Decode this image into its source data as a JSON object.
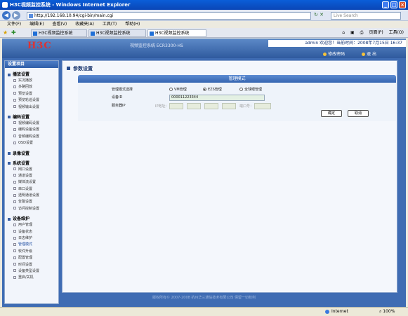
{
  "window": {
    "title": "H3C视频监控系统 - Windows Internet Explorer"
  },
  "addressbar": {
    "url": "http://192.168.10.94/cgi-bin/main.cgi",
    "search_placeholder": "Live Search"
  },
  "menubar": [
    "文件(F)",
    "编辑(E)",
    "查看(V)",
    "收藏夹(A)",
    "工具(T)",
    "帮助(H)"
  ],
  "tabs": [
    {
      "label": "H3C视频监控系统"
    },
    {
      "label": "H3C视频监控系统"
    },
    {
      "label": "H3C视频监控系统"
    }
  ],
  "toolbar_right": {
    "page": "页面(P)",
    "tools": "工具(O)"
  },
  "header": {
    "logo": "H3C",
    "product": "视频监控系统 ECR3300-HS",
    "user_info": "admin 欢迎您！当前时间：2008年7月15日 16:37",
    "change_password": "修改密码",
    "logout": "退 出"
  },
  "sidebar": {
    "title": "设置项目",
    "groups": [
      {
        "title": "播放设置",
        "items": [
          "实况播放",
          "多路回放",
          "预览设置",
          "预览轮巡设置",
          "视频输出设置"
        ]
      },
      {
        "title": "编码设置",
        "items": [
          "视频编码设置",
          "编码设备设置",
          "音频编码设置",
          "OSD设置"
        ]
      },
      {
        "title": "录像设置",
        "items": []
      },
      {
        "title": "系统设置",
        "items": [
          "网口设置",
          "通道设置",
          "媒体流设置",
          "串口设置",
          "透明通道设置",
          "告警设置",
          "访问控制设置"
        ]
      },
      {
        "title": "设备维护",
        "items": [
          "用户管理",
          "设备状态",
          "日志维护",
          "管理模式",
          "软件升级",
          "配置管理",
          "时间设置",
          "设备类型设置",
          "重启/关机"
        ]
      }
    ],
    "active_item": "管理模式"
  },
  "main": {
    "breadcrumb": "参数设置",
    "panel_title": "管理模式",
    "mode_label": "管理模式选择",
    "mode_options": [
      "VM管理",
      "EZS管理",
      "全球眼管理"
    ],
    "mode_selected": "EZS管理",
    "device_id_label": "设备ID",
    "device_id_value": "000011223344",
    "server_label": "服务器IP",
    "ip_label": "IP地址：",
    "port_label": "端口号：",
    "confirm_button": "确定",
    "cancel_button": "取消"
  },
  "footer": "版权所有© 2007-2008 杭州华三通信技术有限公司 保留一切权利",
  "statusbar": {
    "zone": "Internet",
    "zoom": "100%"
  }
}
